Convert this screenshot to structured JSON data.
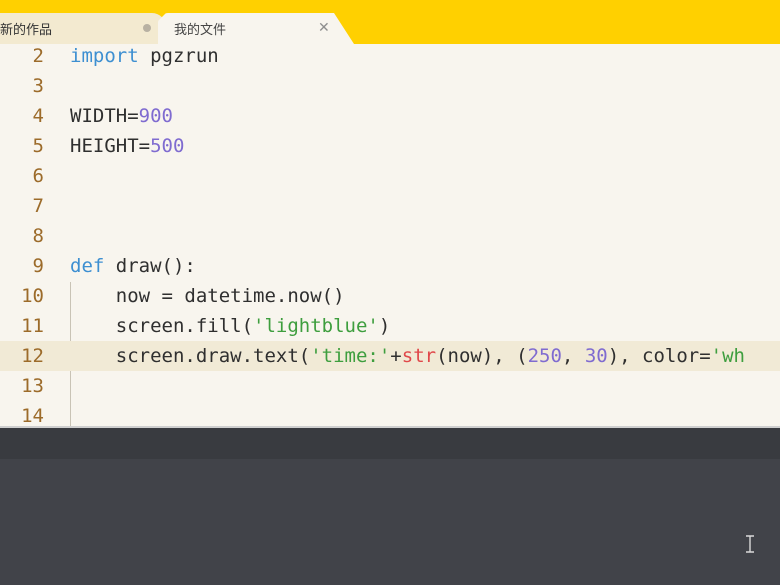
{
  "tabs": [
    {
      "label": "新的作品",
      "state": "inactive",
      "indicator": "unsaved-dot-icon"
    },
    {
      "label": "我的文件",
      "state": "active",
      "close_glyph": "✕"
    }
  ],
  "editor": {
    "current_line": 12,
    "lines": [
      {
        "number": "2",
        "tokens": [
          {
            "t": "import",
            "c": "kw"
          },
          {
            "t": " pgzrun",
            "c": "plain"
          }
        ]
      },
      {
        "number": "3",
        "tokens": []
      },
      {
        "number": "4",
        "tokens": [
          {
            "t": "WIDTH=",
            "c": "plain"
          },
          {
            "t": "900",
            "c": "num"
          }
        ]
      },
      {
        "number": "5",
        "tokens": [
          {
            "t": "HEIGHT=",
            "c": "plain"
          },
          {
            "t": "500",
            "c": "num"
          }
        ]
      },
      {
        "number": "6",
        "tokens": []
      },
      {
        "number": "7",
        "tokens": []
      },
      {
        "number": "8",
        "tokens": []
      },
      {
        "number": "9",
        "tokens": [
          {
            "t": "def",
            "c": "kw"
          },
          {
            "t": " draw():",
            "c": "plain"
          }
        ]
      },
      {
        "number": "10",
        "tokens": [
          {
            "t": "    now = datetime.now()",
            "c": "plain"
          }
        ]
      },
      {
        "number": "11",
        "tokens": [
          {
            "t": "    screen.fill(",
            "c": "plain"
          },
          {
            "t": "'lightblue'",
            "c": "str"
          },
          {
            "t": ")",
            "c": "plain"
          }
        ]
      },
      {
        "number": "12",
        "tokens": [
          {
            "t": "    screen.draw.text(",
            "c": "plain"
          },
          {
            "t": "'time:'",
            "c": "str"
          },
          {
            "t": "+",
            "c": "plain"
          },
          {
            "t": "str",
            "c": "builtin"
          },
          {
            "t": "(now), (",
            "c": "plain"
          },
          {
            "t": "250",
            "c": "num"
          },
          {
            "t": ", ",
            "c": "plain"
          },
          {
            "t": "30",
            "c": "num"
          },
          {
            "t": "), color=",
            "c": "plain"
          },
          {
            "t": "'wh",
            "c": "str"
          }
        ]
      },
      {
        "number": "13",
        "tokens": []
      },
      {
        "number": "14",
        "tokens": []
      }
    ]
  },
  "console": {
    "cursor_icon": "text-cursor-icon"
  }
}
